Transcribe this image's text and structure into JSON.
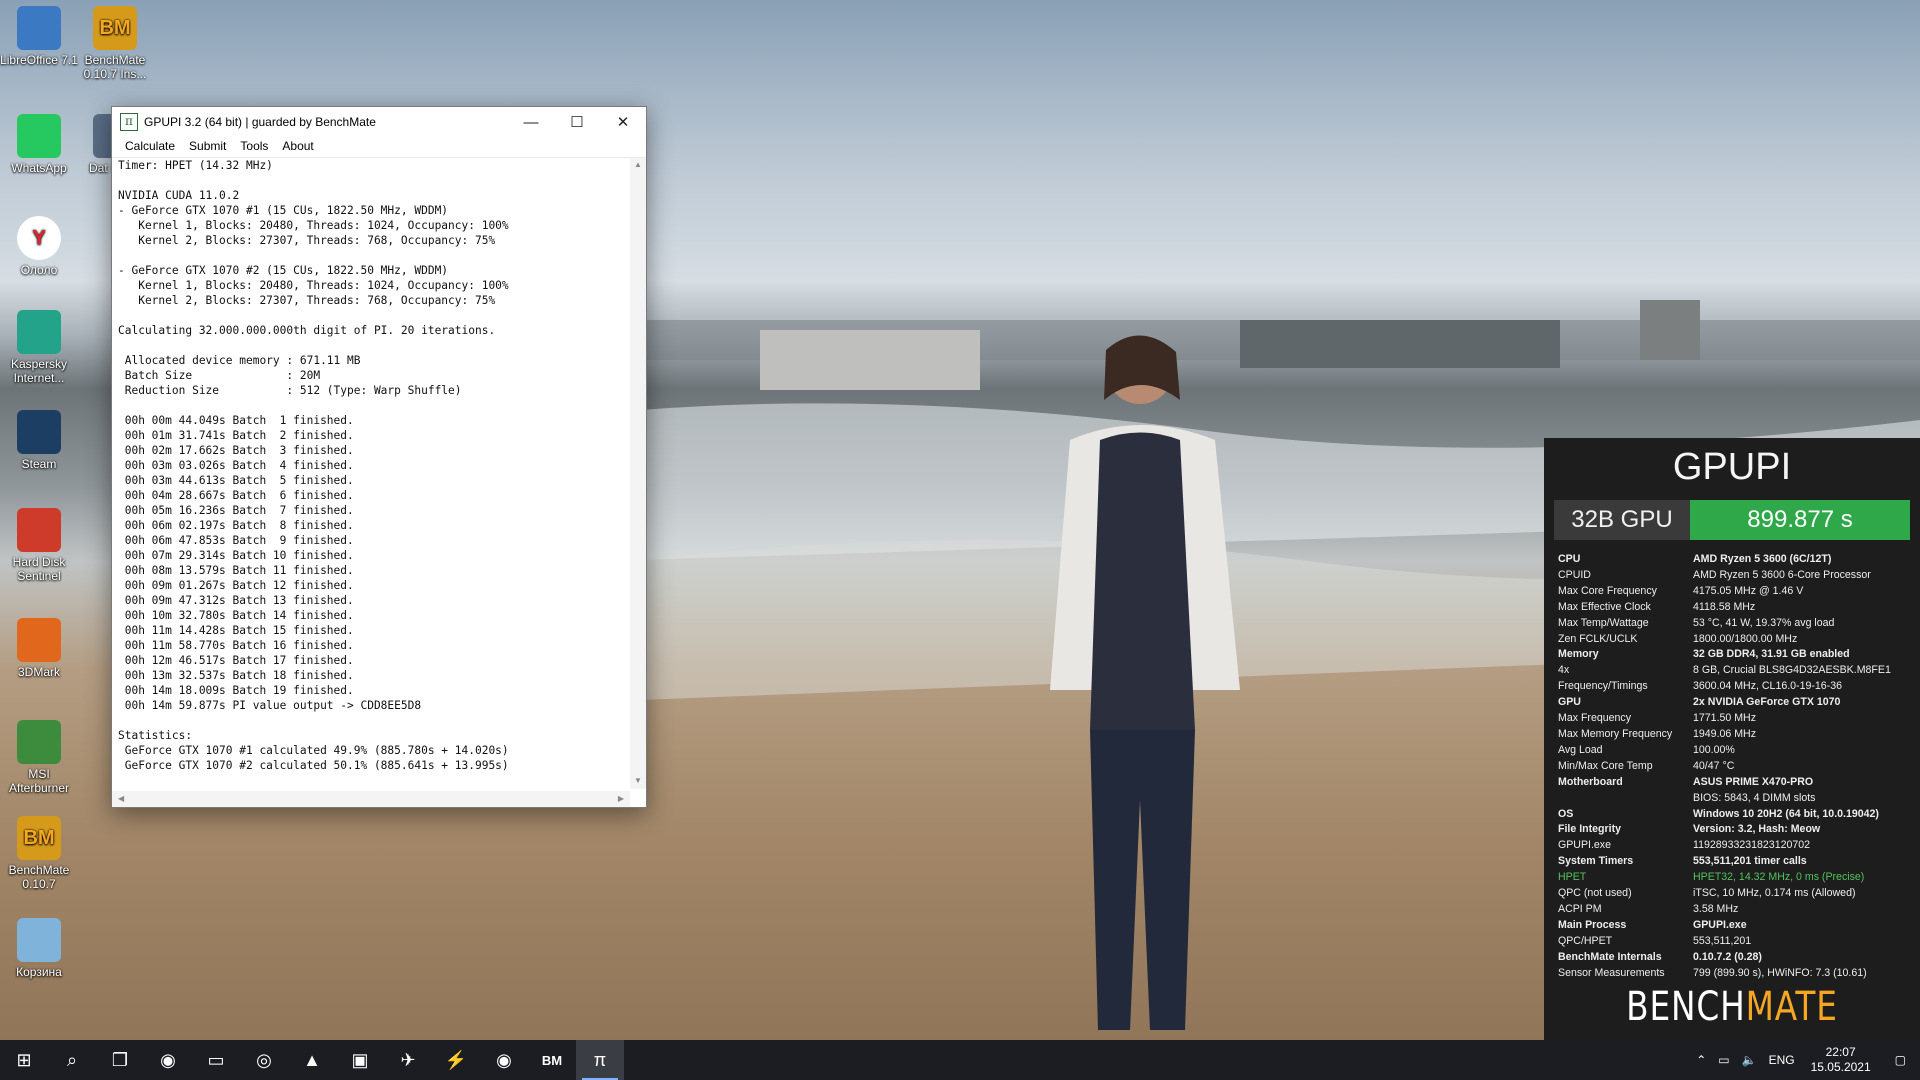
{
  "desktop_icons": [
    {
      "label": "LibreOffice 7.1",
      "icon": "libreoffice-icon"
    },
    {
      "label": "BenchMate 0.10.7 Ins...",
      "icon": "benchmate-icon"
    },
    {
      "label": "WhatsApp",
      "icon": "whatsapp-icon"
    },
    {
      "label": "Dat Migra",
      "icon": "data-migration-icon"
    },
    {
      "label": "Ололо",
      "icon": "yandex-browser-icon"
    },
    {
      "label": "Kaspersky Internet...",
      "icon": "kaspersky-icon"
    },
    {
      "label": "Steam",
      "icon": "steam-icon"
    },
    {
      "label": "Hard Disk Sentinel",
      "icon": "hard-disk-sentinel-icon"
    },
    {
      "label": "3DMark",
      "icon": "3dmark-icon"
    },
    {
      "label": "MSI Afterburner",
      "icon": "msi-afterburner-icon"
    },
    {
      "label": "BenchMate 0.10.7",
      "icon": "benchmate-icon"
    },
    {
      "label": "Корзина",
      "icon": "recycle-bin-icon"
    }
  ],
  "gpupi_window": {
    "app_icon": "π",
    "title": "GPUPI 3.2 (64 bit) | guarded by BenchMate",
    "controls": {
      "minimize": "—",
      "maximize": "☐",
      "close": "✕"
    },
    "menu": [
      "Calculate",
      "Submit",
      "Tools",
      "About"
    ],
    "console_lines": [
      "Timer: HPET (14.32 MHz)",
      "",
      "NVIDIA CUDA 11.0.2",
      "- GeForce GTX 1070 #1 (15 CUs, 1822.50 MHz, WDDM)",
      "   Kernel 1, Blocks: 20480, Threads: 1024, Occupancy: 100%",
      "   Kernel 2, Blocks: 27307, Threads: 768, Occupancy: 75%",
      "",
      "- GeForce GTX 1070 #2 (15 CUs, 1822.50 MHz, WDDM)",
      "   Kernel 1, Blocks: 20480, Threads: 1024, Occupancy: 100%",
      "   Kernel 2, Blocks: 27307, Threads: 768, Occupancy: 75%",
      "",
      "Calculating 32.000.000.000th digit of PI. 20 iterations.",
      "",
      " Allocated device memory : 671.11 MB",
      " Batch Size              : 20M",
      " Reduction Size          : 512 (Type: Warp Shuffle)",
      "",
      " 00h 00m 44.049s Batch  1 finished.",
      " 00h 01m 31.741s Batch  2 finished.",
      " 00h 02m 17.662s Batch  3 finished.",
      " 00h 03m 03.026s Batch  4 finished.",
      " 00h 03m 44.613s Batch  5 finished.",
      " 00h 04m 28.667s Batch  6 finished.",
      " 00h 05m 16.236s Batch  7 finished.",
      " 00h 06m 02.197s Batch  8 finished.",
      " 00h 06m 47.853s Batch  9 finished.",
      " 00h 07m 29.314s Batch 10 finished.",
      " 00h 08m 13.579s Batch 11 finished.",
      " 00h 09m 01.267s Batch 12 finished.",
      " 00h 09m 47.312s Batch 13 finished.",
      " 00h 10m 32.780s Batch 14 finished.",
      " 00h 11m 14.428s Batch 15 finished.",
      " 00h 11m 58.770s Batch 16 finished.",
      " 00h 12m 46.517s Batch 17 finished.",
      " 00h 13m 32.537s Batch 18 finished.",
      " 00h 14m 18.009s Batch 19 finished.",
      " 00h 14m 59.877s PI value output -> CDD8EE5D8",
      "",
      "Statistics:",
      " GeForce GTX 1070 #1 calculated 49.9% (885.780s + 14.020s)",
      " GeForce GTX 1070 #2 calculated 50.1% (885.641s + 13.995s)"
    ]
  },
  "benchmate": {
    "title": "GPUPI",
    "score_label": "32B GPU",
    "score_value": "899.877 s",
    "rows": [
      {
        "k": "CPU",
        "v": "AMD Ryzen 5 3600 (6C/12T)",
        "style": "h"
      },
      {
        "k": "CPUID",
        "v": "AMD Ryzen 5 3600 6-Core Processor",
        "style": ""
      },
      {
        "k": "Max Core Frequency",
        "v": "4175.05 MHz @ 1.46 V",
        "style": ""
      },
      {
        "k": "Max Effective Clock",
        "v": "4118.58 MHz",
        "style": ""
      },
      {
        "k": "Max Temp/Wattage",
        "v": "53 °C, 41 W, 19.37% avg load",
        "style": ""
      },
      {
        "k": "Zen FCLK/UCLK",
        "v": "1800.00/1800.00 MHz",
        "style": ""
      },
      {
        "k": "Memory",
        "v": "32 GB DDR4, 31.91 GB enabled",
        "style": "h"
      },
      {
        "k": "4x",
        "v": "8 GB, Crucial BLS8G4D32AESBK.M8FE1",
        "style": ""
      },
      {
        "k": "Frequency/Timings",
        "v": "3600.04 MHz, CL16.0-19-16-36",
        "style": ""
      },
      {
        "k": "GPU",
        "v": "2x NVIDIA GeForce GTX 1070",
        "style": "h"
      },
      {
        "k": "Max Frequency",
        "v": "1771.50 MHz",
        "style": ""
      },
      {
        "k": "Max Memory Frequency",
        "v": "1949.06 MHz",
        "style": ""
      },
      {
        "k": "Avg Load",
        "v": "100.00%",
        "style": ""
      },
      {
        "k": "Min/Max Core Temp",
        "v": "40/47 °C",
        "style": ""
      },
      {
        "k": "Motherboard",
        "v": "ASUS PRIME X470-PRO",
        "style": "h"
      },
      {
        "k": "",
        "v": "BIOS: 5843, 4 DIMM slots",
        "style": ""
      },
      {
        "k": "OS",
        "v": "Windows 10 20H2 (64 bit, 10.0.19042)",
        "style": "h"
      },
      {
        "k": "File Integrity",
        "v": "Version: 3.2, Hash: Meow",
        "style": "h"
      },
      {
        "k": "GPUPI.exe",
        "v": "11928933231823120702",
        "style": ""
      },
      {
        "k": "System Timers",
        "v": "553,511,201 timer calls",
        "style": "h"
      },
      {
        "k": "HPET",
        "v": "HPET32, 14.32 MHz, 0 ms (Precise)",
        "style": "g"
      },
      {
        "k": "QPC (not used)",
        "v": "iTSC, 10 MHz, 0.174 ms (Allowed)",
        "style": ""
      },
      {
        "k": "ACPI PM",
        "v": "3.58 MHz",
        "style": ""
      },
      {
        "k": "Main Process",
        "v": "GPUPI.exe",
        "style": "h"
      },
      {
        "k": "QPC/HPET",
        "v": "553,511,201",
        "style": ""
      },
      {
        "k": "BenchMate Internals",
        "v": "0.10.7.2 (0.28)",
        "style": "h"
      },
      {
        "k": "Sensor Measurements",
        "v": "799 (899.90 s), HWiNFO: 7.3 (10.61)",
        "style": ""
      }
    ],
    "logo_part1": "BENCH",
    "logo_part2": "MATE"
  },
  "taskbar": {
    "items": [
      {
        "icon": "windows-start-icon",
        "glyph": "⊞",
        "active": false
      },
      {
        "icon": "search-icon",
        "glyph": "⌕",
        "active": false
      },
      {
        "icon": "task-view-icon",
        "glyph": "❐",
        "active": false
      },
      {
        "icon": "steam-icon",
        "glyph": "◉",
        "active": false
      },
      {
        "icon": "file-explorer-icon",
        "glyph": "▭",
        "active": false
      },
      {
        "icon": "chrome-icon",
        "glyph": "◎",
        "active": false
      },
      {
        "icon": "triangle-app-icon",
        "glyph": "▲",
        "active": false
      },
      {
        "icon": "terminal-icon",
        "glyph": "▣",
        "active": false
      },
      {
        "icon": "telegram-icon",
        "glyph": "✈",
        "active": false
      },
      {
        "icon": "lightning-app-icon",
        "glyph": "⚡",
        "active": false
      },
      {
        "icon": "steam-icon",
        "glyph": "◉",
        "active": false
      },
      {
        "icon": "benchmate-icon",
        "glyph": "BM",
        "active": false
      },
      {
        "icon": "gpupi-icon",
        "glyph": "π",
        "active": true
      }
    ],
    "language": "ENG",
    "time": "22:07",
    "date": "15.05.2021"
  }
}
